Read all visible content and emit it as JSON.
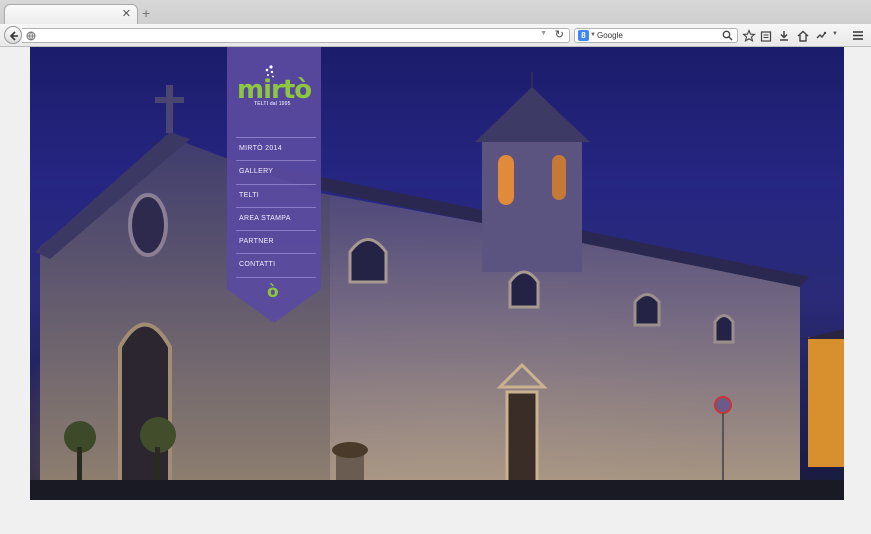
{
  "browser": {
    "search_placeholder": "Google",
    "search_engine_letter": "8",
    "icons": [
      "back-arrow-icon",
      "globe-icon",
      "reload-icon",
      "google-icon",
      "search-icon",
      "star-icon",
      "reading-list-icon",
      "download-icon",
      "home-icon",
      "addon-icon",
      "hamburger-menu-icon"
    ]
  },
  "site": {
    "logo": {
      "word": "mirtò",
      "tagline": "TELTI dal 1995"
    },
    "menu": [
      {
        "label": "MIRTÒ 2014"
      },
      {
        "label": "GALLERY"
      },
      {
        "label": "TELTI"
      },
      {
        "label": "AREA STAMPA"
      },
      {
        "label": "PARTNER"
      },
      {
        "label": "CONTATTI"
      }
    ],
    "bottom_mark": "ò",
    "colors": {
      "menu_purple": "#5a4aa0",
      "brand_green": "#8dc63f",
      "night_sky": "#26267f"
    },
    "background_image": "night-church-photo"
  }
}
